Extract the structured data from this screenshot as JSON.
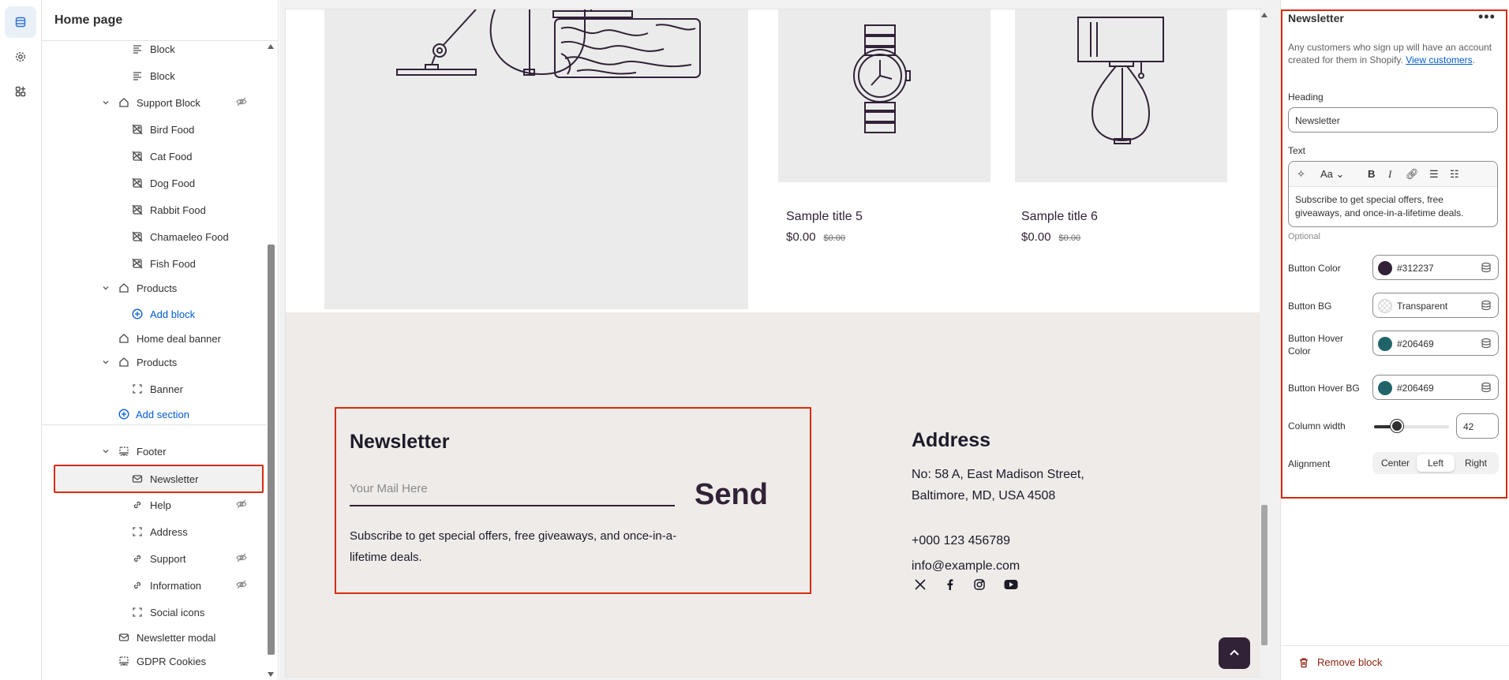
{
  "tree": {
    "title": "Home page",
    "rows": [
      {
        "label": "Block",
        "kind": "block"
      },
      {
        "label": "Block",
        "kind": "block"
      },
      {
        "label": "Support Block",
        "kind": "section"
      },
      {
        "label": "Bird Food",
        "kind": "image-block"
      },
      {
        "label": "Cat Food",
        "kind": "image-block"
      },
      {
        "label": "Dog Food",
        "kind": "image-block"
      },
      {
        "label": "Rabbit Food",
        "kind": "image-block"
      },
      {
        "label": "Chamaeleo Food",
        "kind": "image-block"
      },
      {
        "label": "Fish Food",
        "kind": "image-block"
      },
      {
        "label": "Products",
        "kind": "section"
      },
      {
        "label": "Add block",
        "kind": "add"
      },
      {
        "label": "Home deal banner",
        "kind": "section"
      },
      {
        "label": "Products",
        "kind": "section"
      },
      {
        "label": "Banner",
        "kind": "frame-block"
      },
      {
        "label": "Add section",
        "kind": "add"
      },
      {
        "label": "Footer",
        "kind": "footer"
      },
      {
        "label": "Newsletter",
        "kind": "mail-block"
      },
      {
        "label": "Help",
        "kind": "link-block"
      },
      {
        "label": "Address",
        "kind": "frame-block"
      },
      {
        "label": "Support",
        "kind": "link-block"
      },
      {
        "label": "Information",
        "kind": "link-block"
      },
      {
        "label": "Social icons",
        "kind": "frame-block"
      },
      {
        "label": "Newsletter modal",
        "kind": "mail-section"
      },
      {
        "label": "GDPR Cookies",
        "kind": "footer"
      }
    ]
  },
  "preview": {
    "products": [
      {
        "title": "Sample title 5",
        "price": "$0.00",
        "compare": "$0.00"
      },
      {
        "title": "Sample title 6",
        "price": "$0.00",
        "compare": "$0.00"
      }
    ],
    "newsletter": {
      "heading": "Newsletter",
      "placeholder": "Your Mail Here",
      "send": "Send",
      "text": "Subscribe to get special offers, free giveaways, and once-in-a-lifetime deals."
    },
    "address": {
      "heading": "Address",
      "line1": "No: 58 A, East Madison Street,",
      "line2": "Baltimore, MD, USA 4508",
      "phone": "+000 123 456789",
      "email": "info@example.com"
    },
    "social_icons": [
      "x-icon",
      "facebook-icon",
      "instagram-icon",
      "youtube-icon"
    ]
  },
  "settings": {
    "title": "Newsletter",
    "more": "•••",
    "desc_text": "Any customers who sign up will have an account created for them in Shopify.",
    "desc_link": "View customers",
    "desc_end": ".",
    "heading_label": "Heading",
    "heading_value": "Newsletter",
    "text_label": "Text",
    "text_value": "Subscribe to get special offers, free giveaways, and once-in-a-lifetime deals.",
    "optional": "Optional",
    "colors": [
      {
        "label": "Button Color",
        "value": "#312237",
        "swatch": "#312237"
      },
      {
        "label": "Button BG",
        "value": "Transparent",
        "swatch": "transparent"
      },
      {
        "label": "Button Hover Color",
        "value": "#206469",
        "swatch": "#206469"
      },
      {
        "label": "Button Hover BG",
        "value": "#206469",
        "swatch": "#206469"
      }
    ],
    "column_width_label": "Column width",
    "column_width_value": "42",
    "column_width_fraction": 0.3,
    "alignment_label": "Alignment",
    "alignment_options": [
      "Center",
      "Left",
      "Right"
    ],
    "alignment_selected": "Left",
    "remove_label": "Remove block"
  }
}
